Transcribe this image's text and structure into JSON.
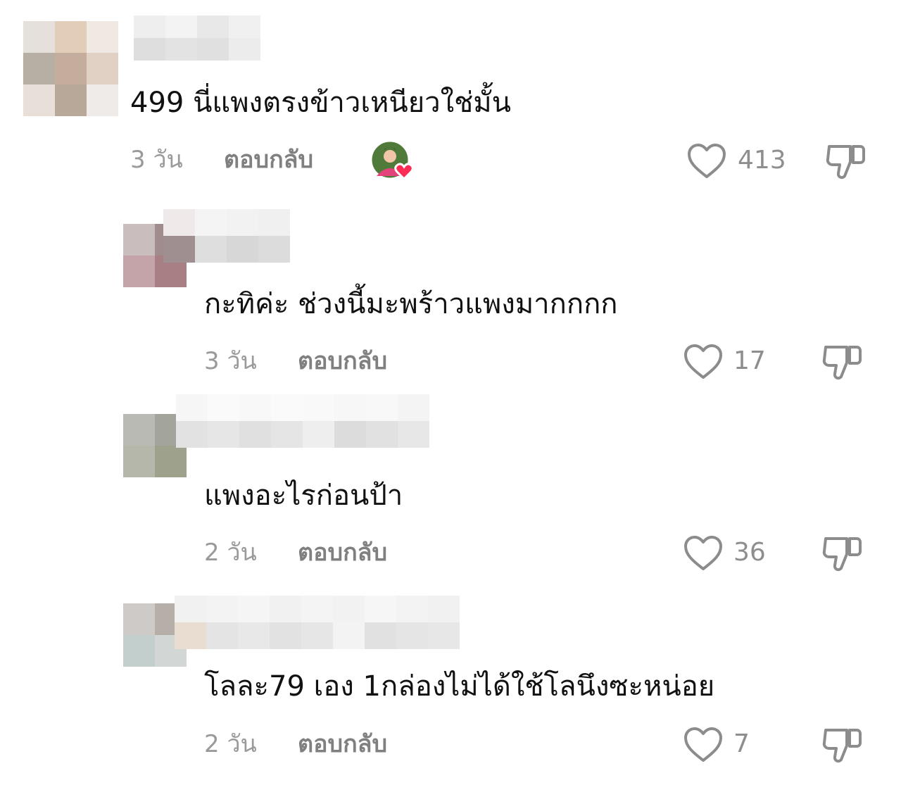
{
  "comments": [
    {
      "text": "499 นี่แพงตรงข้าวเหนียวใช่มั้น",
      "time": "3 วัน",
      "reply_label": "ตอบกลับ",
      "likes": "413",
      "creator_liked": true
    },
    {
      "text": "กะทิค่ะ ช่วงนี้มะพร้าวแพงมากกกก",
      "time": "3 วัน",
      "reply_label": "ตอบกลับ",
      "likes": "17"
    },
    {
      "text": "แพงอะไรก่อนป้า",
      "time": "2 วัน",
      "reply_label": "ตอบกลับ",
      "likes": "36"
    },
    {
      "text": "โลละ79 เอง 1กล่องไม่ได้ใช้โลนึงซะหน่อย",
      "time": "2 วัน",
      "reply_label": "ตอบกลับ",
      "likes": "7"
    }
  ],
  "icons": {
    "like": "heart-outline-icon",
    "dislike": "thumbs-down-icon",
    "creator_badge": "creator-avatar-heart-icon"
  },
  "colors": {
    "text": "#111111",
    "meta": "#9a9a9a",
    "heart_badge": "#fe2c55"
  }
}
